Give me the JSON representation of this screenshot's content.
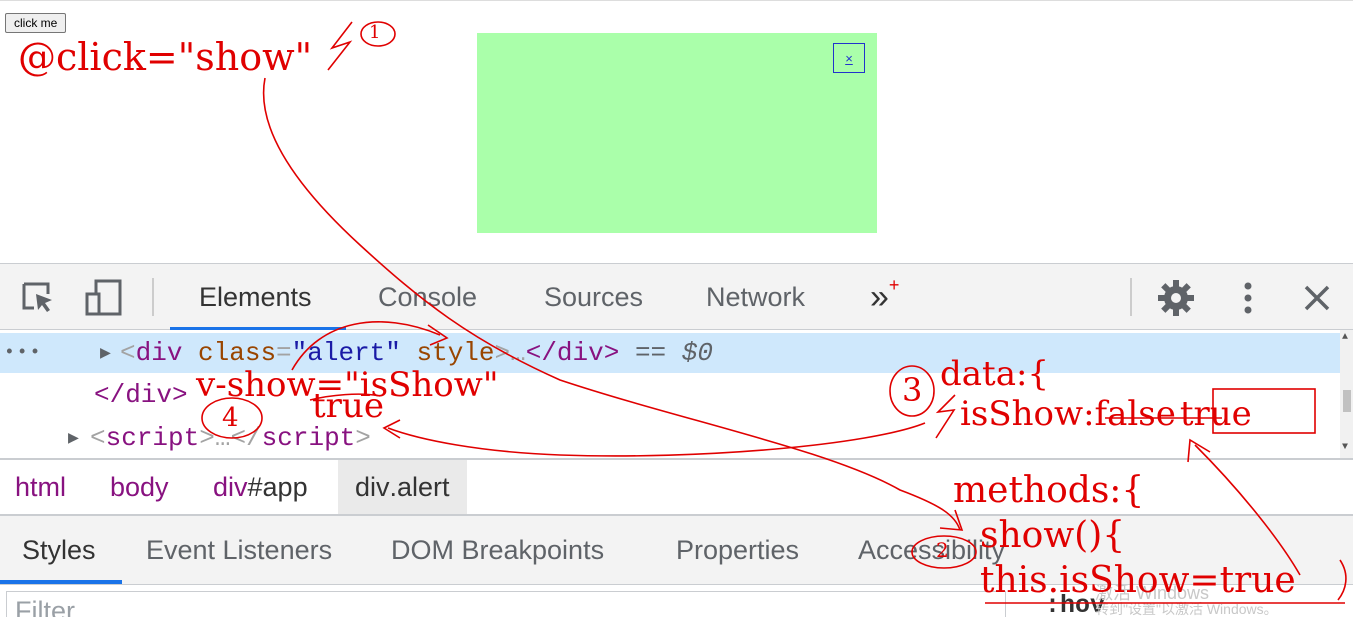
{
  "page": {
    "button_label": "click me",
    "alert_close_label": "×"
  },
  "devtools": {
    "tabs": [
      {
        "label": "Elements"
      },
      {
        "label": "Console"
      },
      {
        "label": "Sources"
      },
      {
        "label": "Network"
      }
    ],
    "more_tabs_glyph": "»",
    "icons": [
      "inspect-icon",
      "device-toggle-icon",
      "gear-icon",
      "kebab-icon",
      "close-icon"
    ],
    "dom_rows": {
      "row1": {
        "ellipsis": "•••",
        "open": "<",
        "tag": "div",
        "attr1": "class",
        "eq": "=",
        "val1": "\"alert\"",
        "attr2": "style",
        "gt_ellipsis": ">…",
        "close": "</div>",
        "ref": "== $0"
      },
      "row2": {
        "text": "</div>"
      },
      "row3": {
        "open": "<",
        "tag": "script",
        "middle": ">…</",
        "tag2": "script",
        "close": ">"
      }
    },
    "breadcrumbs": [
      {
        "tag": "html",
        "suffix": ""
      },
      {
        "tag": "body",
        "suffix": ""
      },
      {
        "tag": "div",
        "suffix": "#app"
      },
      {
        "tag": "div",
        "suffix": ".alert"
      }
    ],
    "subtabs": [
      {
        "label": "Styles"
      },
      {
        "label": "Event Listeners"
      },
      {
        "label": "DOM Breakpoints"
      },
      {
        "label": "Properties"
      },
      {
        "label": "Accessibility"
      }
    ],
    "filter_placeholder": "Filter",
    "hov_label": ":hov",
    "watermark_line1": "激活 Windows",
    "watermark_line2": "转到\"设置\"以激活 Windows。"
  },
  "annotations": {
    "click_handler": "@click=\"show\"",
    "step1": "1",
    "v_show": "v-show=\"isShow\"",
    "v_show_true": "true",
    "step4": "4",
    "data_open": "data:{",
    "step3": "3",
    "is_show_key": "isShow:",
    "is_show_false": "false",
    "is_show_true": "true",
    "methods_open": "methods:{",
    "show_fn": "show(){",
    "step2": "2",
    "assign": "this.isShow=true",
    "color": "#e00000"
  },
  "colors": {
    "alert_bg": "#aaffaa",
    "accent": "#1a73e8",
    "selected_row": "#cfe8fc",
    "annotation_red": "#e00000"
  }
}
